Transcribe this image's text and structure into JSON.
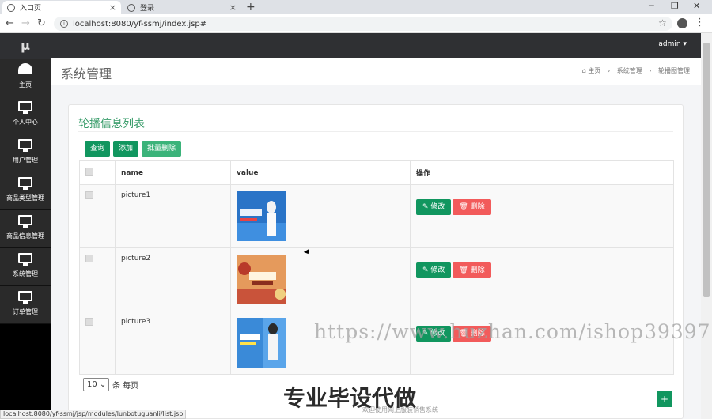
{
  "browser": {
    "tabs": [
      {
        "title": "入口页"
      },
      {
        "title": "登录"
      }
    ],
    "new_tab": "+",
    "url": "localhost:8080/yf-ssmj/index.jsp#",
    "status_url": "localhost:8080/yf-ssmj/jsp/modules/lunbotuguanli/list.jsp"
  },
  "sidebar": {
    "logo": "μ",
    "items": [
      {
        "label": "主页",
        "icon": "dashboard-icon"
      },
      {
        "label": "个人中心",
        "icon": "monitor-icon"
      },
      {
        "label": "用户管理",
        "icon": "monitor-icon"
      },
      {
        "label": "商品类型管理",
        "icon": "monitor-icon"
      },
      {
        "label": "商品信息管理",
        "icon": "monitor-icon"
      },
      {
        "label": "系统管理",
        "icon": "monitor-icon"
      },
      {
        "label": "订单管理",
        "icon": "monitor-icon"
      }
    ]
  },
  "topbar": {
    "user": "admin ▾"
  },
  "page": {
    "title": "系统管理",
    "breadcrumb": [
      "⌂ 主页",
      "›",
      "系统管理",
      "›",
      "轮播图管理"
    ]
  },
  "panel": {
    "title": "轮播信息列表",
    "buttons": {
      "query": "查询",
      "add": "添加",
      "batch_delete": "批量删除"
    },
    "columns": {
      "name": "name",
      "value": "value",
      "action": "操作"
    },
    "rows": [
      {
        "name": "picture1",
        "edit": "✎ 修改",
        "delete": "🗑 删除"
      },
      {
        "name": "picture2",
        "edit": "✎ 修改",
        "delete": "🗑 删除"
      },
      {
        "name": "picture3",
        "edit": "✎ 修改",
        "delete": "🗑 删除"
      }
    ],
    "page_size": "10",
    "page_size_suffix": "条 每页",
    "fab": "+"
  },
  "footer": "欢迎使用网上服装销售系统",
  "watermark": {
    "url": "https://www.huzhan.com/ishop39397",
    "slogan": "专业毕设代做"
  }
}
